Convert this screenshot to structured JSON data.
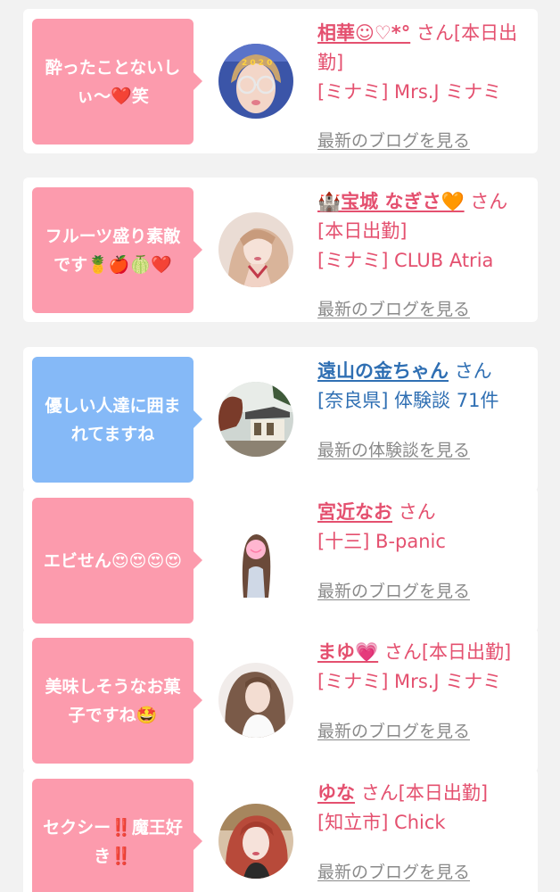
{
  "cards": [
    {
      "comment": "酔ったことないしぃ〜❤️笑",
      "bubble_color": "#fc9bad",
      "name": "相華☺︎♡*°",
      "suffix": "さん[本日出勤]",
      "shop": "[ミナミ] Mrs.J ミナミ",
      "link": "最新のブログを見る",
      "avatar": "woman-with-glasses-photo"
    },
    {
      "comment": "フルーツ盛り素敵です🍍🍎🍈❤️",
      "bubble_color": "#fc9bad",
      "name": "🏰宝城 なぎさ🧡",
      "suffix": "さん[本日出勤]",
      "shop": "[ミナミ] CLUB Atria",
      "link": "最新のブログを見る",
      "avatar": "woman-portrait-photo"
    },
    {
      "comment": "優しい人達に囲まれてますね",
      "bubble_color": "#85b9f7",
      "name": "遠山の金ちゃん",
      "suffix": "さん",
      "shop": "[奈良県] 体験談 71件",
      "link": "最新の体験談を見る",
      "avatar": "japanese-temple-photo"
    },
    {
      "comment": "エビせん😍😍😍😍",
      "bubble_color": "#fc9bad",
      "name": "宮近なお",
      "suffix": "さん",
      "shop": "[十三] B-panic",
      "link": "最新のブログを見る",
      "avatar": "woman-long-hair-photo"
    },
    {
      "comment": "美味しそうなお菓子ですね🤩",
      "bubble_color": "#fc9bad",
      "name": "まゆ💗",
      "suffix": "さん[本日出勤]",
      "shop": "[ミナミ] Mrs.J ミナミ",
      "link": "最新のブログを見る",
      "avatar": "woman-white-top-photo"
    },
    {
      "comment": "セクシー‼️魔王好き‼️",
      "bubble_color": "#fc9bad",
      "name": "ゆな",
      "suffix": "さん[本日出勤]",
      "shop": "[知立市] Chick",
      "link": "最新のブログを見る",
      "avatar": "woman-red-hair-photo"
    }
  ]
}
